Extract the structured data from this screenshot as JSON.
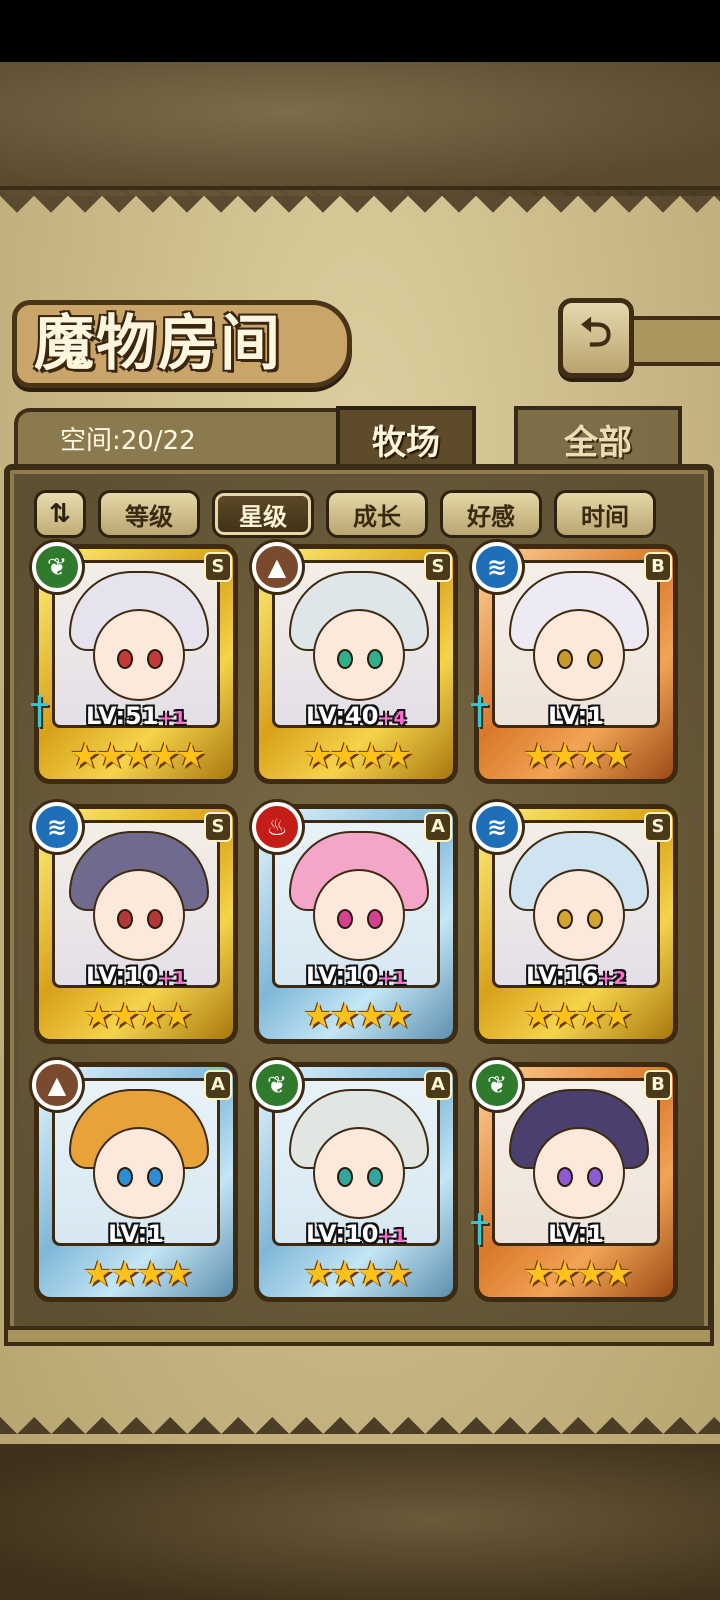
{
  "title": "魔物房间",
  "back_icon": "return-arrow-icon",
  "space": {
    "label": "空间:20/22"
  },
  "tabs": [
    {
      "label": "牧场",
      "active": true
    },
    {
      "label": "全部",
      "active": false
    }
  ],
  "sort": {
    "toggle_icon": "sort-order-icon",
    "buttons": [
      {
        "label": "等级",
        "active": false
      },
      {
        "label": "星级",
        "active": true
      },
      {
        "label": "成长",
        "active": false
      },
      {
        "label": "好感",
        "active": false
      },
      {
        "label": "时间",
        "active": false
      }
    ]
  },
  "monsters": [
    {
      "element": "nature",
      "rank": "S",
      "level": "LV:51",
      "bonus": "+1",
      "stars": 5,
      "frame": "gold",
      "weapon": true
    },
    {
      "element": "earth",
      "rank": "S",
      "level": "LV:40",
      "bonus": "+4",
      "stars": 4,
      "frame": "gold",
      "weapon": false
    },
    {
      "element": "water",
      "rank": "B",
      "level": "LV:1",
      "bonus": "",
      "stars": 4,
      "frame": "orange",
      "weapon": true
    },
    {
      "element": "water",
      "rank": "S",
      "level": "LV:10",
      "bonus": "+1",
      "stars": 4,
      "frame": "gold",
      "weapon": false
    },
    {
      "element": "fire",
      "rank": "A",
      "level": "LV:10",
      "bonus": "+1",
      "stars": 4,
      "frame": "blue",
      "weapon": false
    },
    {
      "element": "water",
      "rank": "S",
      "level": "LV:16",
      "bonus": "+2",
      "stars": 4,
      "frame": "gold",
      "weapon": false
    },
    {
      "element": "earth",
      "rank": "A",
      "level": "LV:1",
      "bonus": "",
      "stars": 4,
      "frame": "blue",
      "weapon": false
    },
    {
      "element": "nature",
      "rank": "A",
      "level": "LV:10",
      "bonus": "+1",
      "stars": 4,
      "frame": "blue",
      "weapon": false
    },
    {
      "element": "nature",
      "rank": "B",
      "level": "LV:1",
      "bonus": "",
      "stars": 4,
      "frame": "orange",
      "weapon": true
    }
  ],
  "colors": {
    "parchment": "#cfc08c",
    "frame_gold": "#d8a11b",
    "frame_blue": "#7fb7d8",
    "frame_orange": "#d9782a",
    "star": "#ffc21a",
    "bonus": "#ff6fd1"
  }
}
